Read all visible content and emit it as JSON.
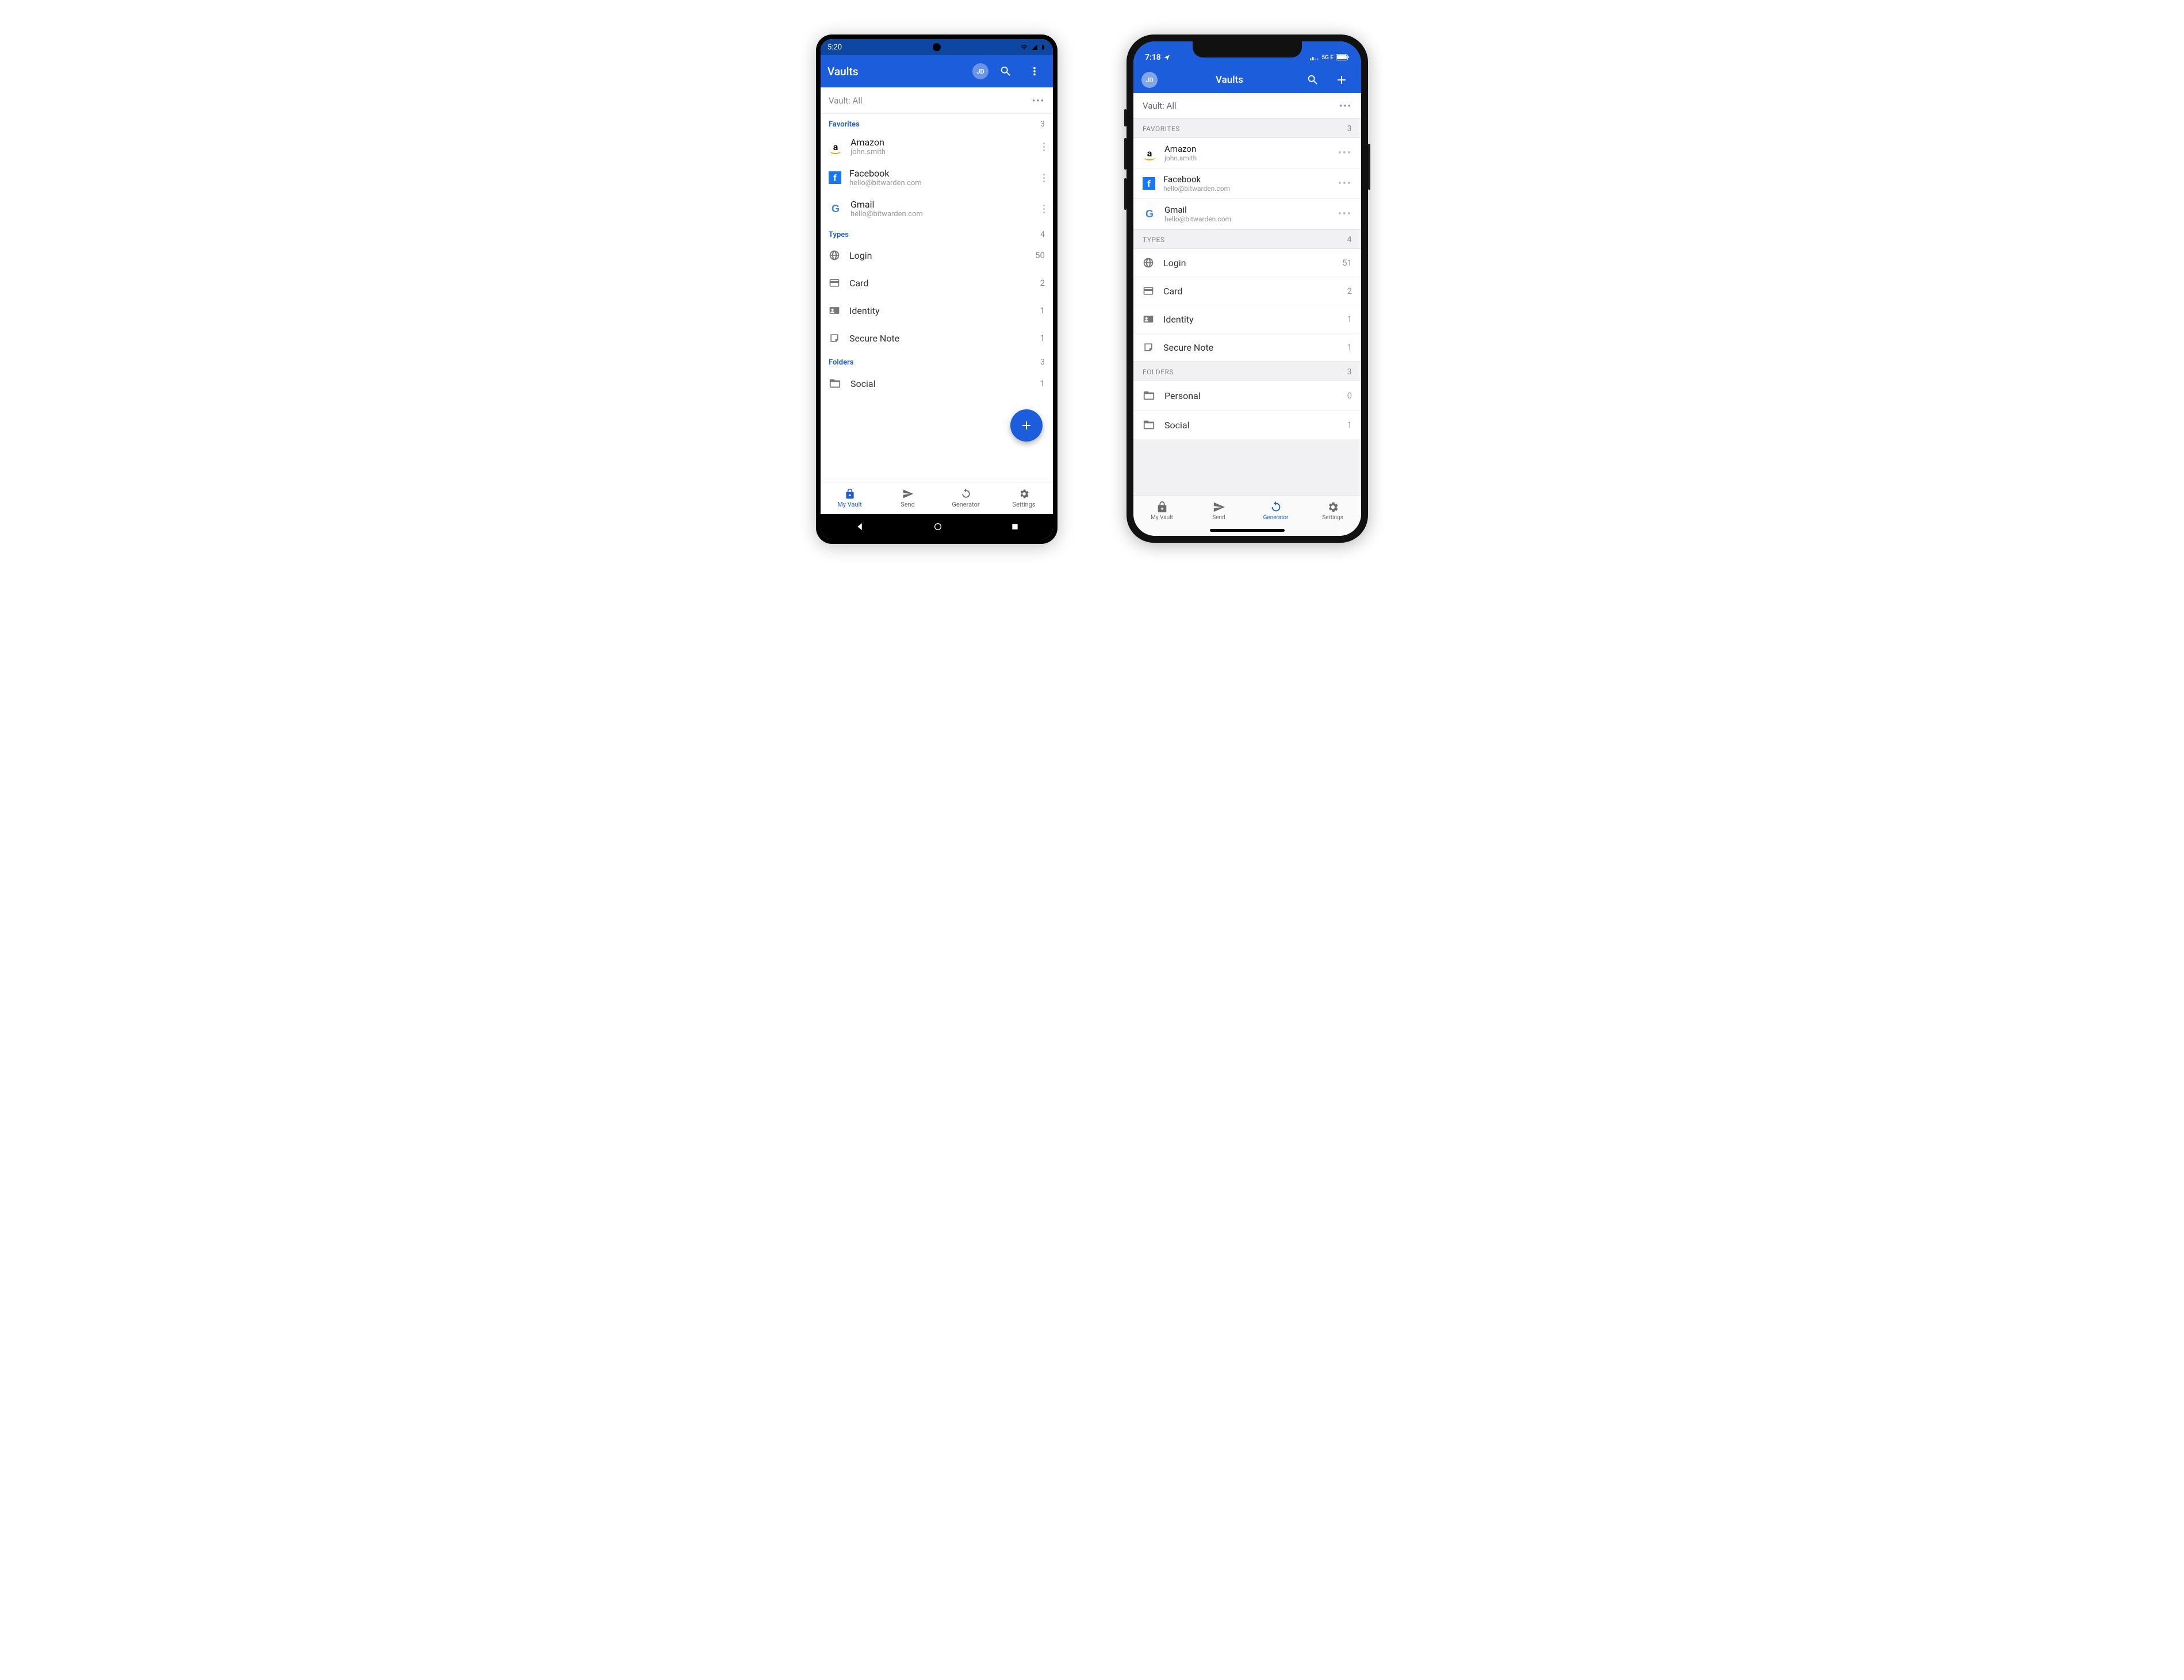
{
  "android": {
    "status": {
      "time": "5:20"
    },
    "appbar": {
      "title": "Vaults",
      "avatarInitials": "JD"
    },
    "filter": {
      "label": "Vault: All"
    },
    "sections": {
      "favorites": {
        "title": "Favorites",
        "count": "3"
      },
      "types": {
        "title": "Types",
        "count": "4"
      },
      "folders": {
        "title": "Folders",
        "count": "3"
      }
    },
    "favoriteItems": [
      {
        "name": "Amazon",
        "sub": "john.smith",
        "icon": "amazon"
      },
      {
        "name": "Facebook",
        "sub": "hello@bitwarden.com",
        "icon": "facebook"
      },
      {
        "name": "Gmail",
        "sub": "hello@bitwarden.com",
        "icon": "gmail"
      }
    ],
    "typeItems": [
      {
        "name": "Login",
        "count": "50"
      },
      {
        "name": "Card",
        "count": "2"
      },
      {
        "name": "Identity",
        "count": "1"
      },
      {
        "name": "Secure Note",
        "count": "1"
      }
    ],
    "folderItems": [
      {
        "name": "Social",
        "count": "1"
      }
    ],
    "bottomNav": {
      "myVault": "My Vault",
      "send": "Send",
      "generator": "Generator",
      "settings": "Settings"
    }
  },
  "ios": {
    "status": {
      "time": "7:18",
      "network": "5G E"
    },
    "navbar": {
      "title": "Vaults",
      "avatarInitials": "JD"
    },
    "filter": {
      "label": "Vault: All"
    },
    "sections": {
      "favorites": {
        "title": "FAVORITES",
        "count": "3"
      },
      "types": {
        "title": "TYPES",
        "count": "4"
      },
      "folders": {
        "title": "FOLDERS",
        "count": "3"
      }
    },
    "favoriteItems": [
      {
        "name": "Amazon",
        "sub": "john.smith",
        "icon": "amazon"
      },
      {
        "name": "Facebook",
        "sub": "hello@bitwarden.com",
        "icon": "facebook"
      },
      {
        "name": "Gmail",
        "sub": "hello@bitwarden.com",
        "icon": "gmail"
      }
    ],
    "typeItems": [
      {
        "name": "Login",
        "count": "51"
      },
      {
        "name": "Card",
        "count": "2"
      },
      {
        "name": "Identity",
        "count": "1"
      },
      {
        "name": "Secure Note",
        "count": "1"
      }
    ],
    "folderItems": [
      {
        "name": "Personal",
        "count": "0"
      },
      {
        "name": "Social",
        "count": "1"
      }
    ],
    "tabbar": {
      "myVault": "My Vault",
      "send": "Send",
      "generator": "Generator",
      "settings": "Settings"
    }
  }
}
